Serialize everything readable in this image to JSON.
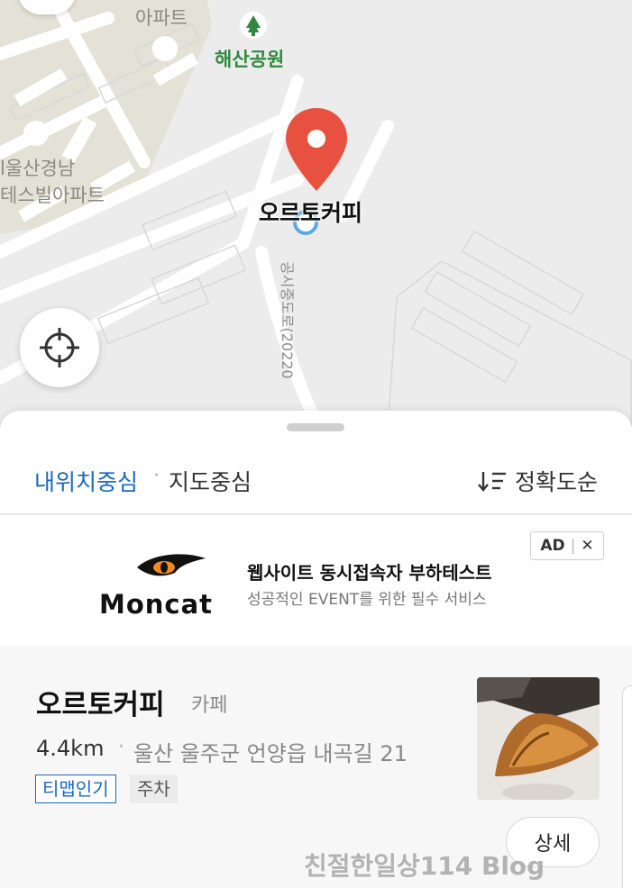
{
  "map": {
    "apartment_label_top": "아파트",
    "park_label": "해산공원",
    "apartment_label_left": "l울산경남\n테스빌아파트",
    "apartment_label_left_line1": "l울산경남",
    "apartment_label_left_line2": "테스빌아파트",
    "place_label": "오르토커피",
    "road_label": "공시중도로(20220",
    "pin_icon": "location-pin-icon",
    "locate_icon": "crosshair-icon",
    "colors": {
      "pin": "#e8513f",
      "apartment_block": "#e4e2d6",
      "road": "#ffffff",
      "park": "#2f8a3e"
    }
  },
  "sheet": {
    "filter_my_location": "내위치중심",
    "filter_separator": "·",
    "filter_map_center": "지도중심",
    "sort_label": "정확도순",
    "sort_icon": "sort-down-icon",
    "accent_color": "#1769c2"
  },
  "ad": {
    "logo_text": "Moncat",
    "title": "웹사이트 동시접속자 부하테스트",
    "subtitle": "성공적인 EVENT를 위한 필수 서비스",
    "badge_label": "AD",
    "badge_close": "✕"
  },
  "result": {
    "name": "오르토커피",
    "category": "카페",
    "distance": "4.4km",
    "separator": "·",
    "address": "울산 울주군 언양읍 내곡길 21",
    "tags": [
      "티맵인기",
      "주차"
    ],
    "detail_button": "상세"
  },
  "watermark": "친절한일상114 Blog"
}
